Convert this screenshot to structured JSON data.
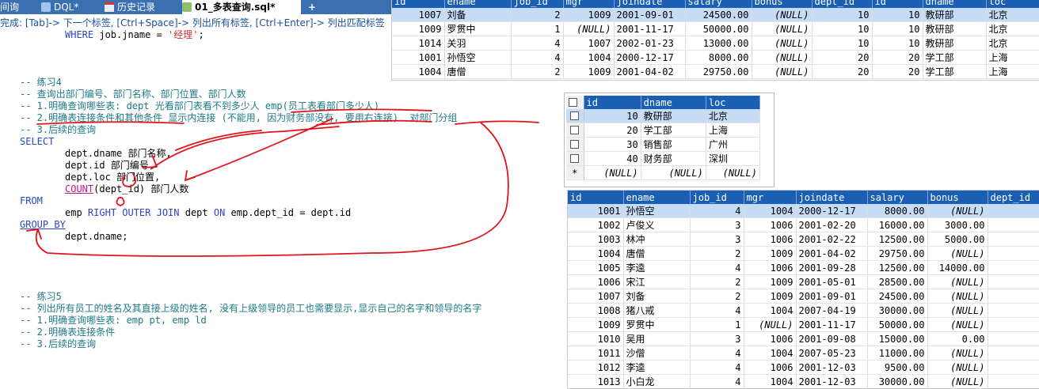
{
  "tabs": [
    {
      "label": "间询"
    },
    {
      "label": "DQL*"
    },
    {
      "label": "历史记录"
    },
    {
      "label": "01_多表查询.sql*"
    },
    {
      "label": "+"
    }
  ],
  "hint": "完成: [Tab]-> 下一个标签, [Ctrl+Space]-> 列出所有标签, [Ctrl+Enter]-> 列出匹配标签",
  "code": {
    "l1_kw": "WHERE",
    "l1_rest": " job.jname = ",
    "l1_str": "'经理'",
    "l1_end": ";",
    "c1": "-- 练习4",
    "c2": "-- 查询出部门编号、部门名称、部门位置、部门人数",
    "c3": "-- 1.明确查询哪些表: dept 光看部门表看不到多少人 emp(员工表看部门多少人)",
    "c4": "-- 2.明确表连接条件和其他条件 显示内连接 (不能用, 因为财务部没有, 要用右连接)  对部门分组",
    "c5": "-- 3.后续的查询",
    "select_kw": "SELECT",
    "s1": "dept.dname 部门名称,",
    "s2": "dept.id 部门编号,",
    "s3": "dept.loc 部门位置,",
    "s4_fn": "COUNT",
    "s4_rest": "(dept_id) 部门人数",
    "from_kw": "FROM",
    "f1_a": "emp ",
    "f1_kw": "RIGHT OUTER JOIN",
    "f1_b": " dept ",
    "f1_on": "ON",
    "f1_c": " emp.dept_id = dept.id",
    "group_kw": "GROUP BY",
    "g1": "dept.dname;",
    "c6": "-- 练习5",
    "c7": "-- 列出所有员工的姓名及其直接上级的姓名, 没有上级领导的员工也需要显示,显示自己的名字和领导的名字",
    "c8": "-- 1.明确查询哪些表: emp pt, emp ld",
    "c9": "-- 2.明确表连接条件",
    "c10": "-- 3.后续的查询"
  },
  "grid1": {
    "headers": [
      "id",
      "ename",
      "job_id",
      "mgr",
      "joindate",
      "salary",
      "bonus",
      "dept_id",
      "id",
      "dname",
      "loc"
    ],
    "rows": [
      [
        "1007",
        "刘备",
        "2",
        "1009",
        "2001-09-01",
        "24500.00",
        "(NULL)",
        "10",
        "10",
        "教研部",
        "北京"
      ],
      [
        "1009",
        "罗贯中",
        "1",
        "(NULL)",
        "2001-11-17",
        "50000.00",
        "(NULL)",
        "10",
        "10",
        "教研部",
        "北京"
      ],
      [
        "1014",
        "关羽",
        "4",
        "1007",
        "2002-01-23",
        "13000.00",
        "(NULL)",
        "10",
        "10",
        "教研部",
        "北京"
      ],
      [
        "1001",
        "孙悟空",
        "4",
        "1004",
        "2000-12-17",
        "8000.00",
        "(NULL)",
        "20",
        "20",
        "学工部",
        "上海"
      ],
      [
        "1004",
        "唐僧",
        "2",
        "1009",
        "2001-04-02",
        "29750.00",
        "(NULL)",
        "20",
        "20",
        "学工部",
        "上海"
      ]
    ]
  },
  "grid2": {
    "headers": [
      "id",
      "dname",
      "loc"
    ],
    "rows": [
      [
        "10",
        "教研部",
        "北京"
      ],
      [
        "20",
        "学工部",
        "上海"
      ],
      [
        "30",
        "销售部",
        "广州"
      ],
      [
        "40",
        "财务部",
        "深圳"
      ],
      [
        "(NULL)",
        "(NULL)",
        "(NULL)"
      ]
    ],
    "new_row_marker": "*"
  },
  "grid3": {
    "headers": [
      "id",
      "ename",
      "job_id",
      "mgr",
      "joindate",
      "salary",
      "bonus",
      "dept_id"
    ],
    "rows": [
      [
        "1001",
        "孙悟空",
        "4",
        "1004",
        "2000-12-17",
        "8000.00",
        "(NULL)",
        "2"
      ],
      [
        "1002",
        "卢俊义",
        "3",
        "1006",
        "2001-02-20",
        "16000.00",
        "3000.00",
        "3"
      ],
      [
        "1003",
        "林冲",
        "3",
        "1006",
        "2001-02-22",
        "12500.00",
        "5000.00",
        "3"
      ],
      [
        "1004",
        "唐僧",
        "2",
        "1009",
        "2001-04-02",
        "29750.00",
        "(NULL)",
        "2"
      ],
      [
        "1005",
        "李逵",
        "4",
        "1006",
        "2001-09-28",
        "12500.00",
        "14000.00",
        "3"
      ],
      [
        "1006",
        "宋江",
        "2",
        "1009",
        "2001-05-01",
        "28500.00",
        "(NULL)",
        "3"
      ],
      [
        "1007",
        "刘备",
        "2",
        "1009",
        "2001-09-01",
        "24500.00",
        "(NULL)",
        "1"
      ],
      [
        "1008",
        "猪八戒",
        "4",
        "1004",
        "2007-04-19",
        "30000.00",
        "(NULL)",
        "2"
      ],
      [
        "1009",
        "罗贯中",
        "1",
        "(NULL)",
        "2001-11-17",
        "50000.00",
        "(NULL)",
        "1"
      ],
      [
        "1010",
        "吴用",
        "3",
        "1006",
        "2001-09-08",
        "15000.00",
        "0.00",
        "3"
      ],
      [
        "1011",
        "沙僧",
        "4",
        "1004",
        "2007-05-23",
        "11000.00",
        "(NULL)",
        "2"
      ],
      [
        "1012",
        "李逵",
        "4",
        "1006",
        "2001-12-03",
        "9500.00",
        "(NULL)",
        "3"
      ],
      [
        "1013",
        "小白龙",
        "4",
        "1004",
        "2001-12-03",
        "30000.00",
        "(NULL)",
        "2"
      ]
    ]
  },
  "colors": {
    "tab_bar": "#3a6fb0",
    "grid_header": "#1a5fb4",
    "selected_row": "#c6dcf5",
    "ink": "#e0141c"
  }
}
